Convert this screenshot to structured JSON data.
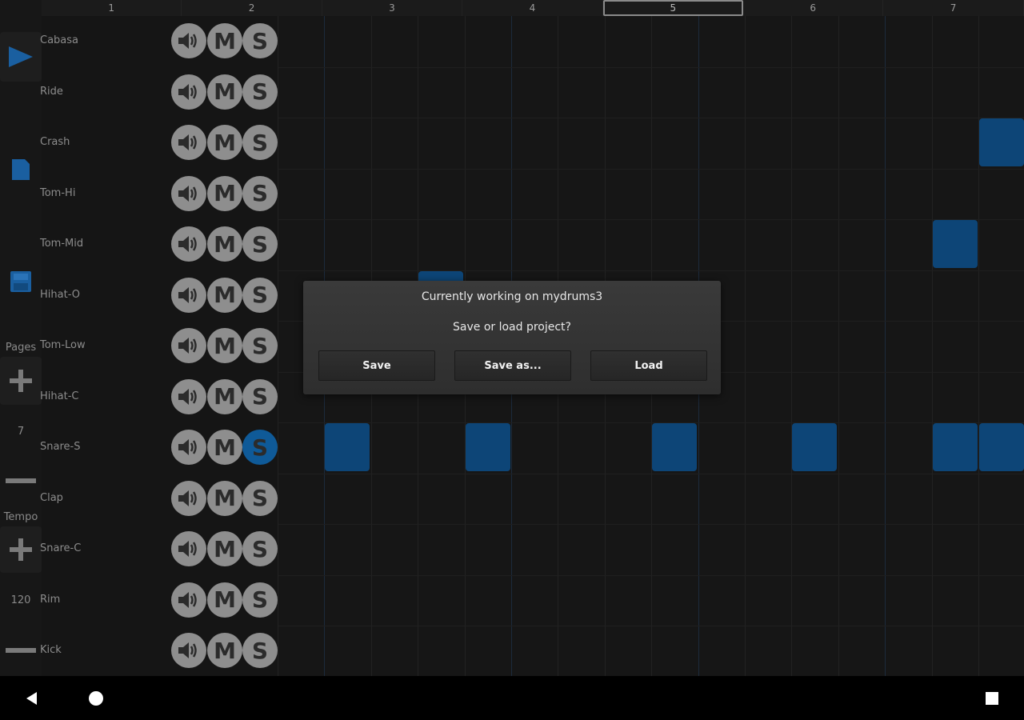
{
  "ruler": {
    "pages": [
      "1",
      "2",
      "3",
      "4",
      "5",
      "6",
      "7"
    ],
    "active_page": "5"
  },
  "toolbar": {
    "play_icon": "play-icon",
    "new_icon": "new-file-icon",
    "save_icon": "save-disk-icon",
    "pages_label": "Pages",
    "pages_value": "7",
    "tempo_label": "Tempo",
    "tempo_value": "120"
  },
  "tracks": [
    {
      "name": "Cabasa",
      "solo": false
    },
    {
      "name": "Ride",
      "solo": false
    },
    {
      "name": "Crash",
      "solo": false
    },
    {
      "name": "Tom-Hi",
      "solo": false
    },
    {
      "name": "Tom-Mid",
      "solo": false
    },
    {
      "name": "Hihat-O",
      "solo": false
    },
    {
      "name": "Tom-Low",
      "solo": false
    },
    {
      "name": "Hihat-C",
      "solo": false
    },
    {
      "name": "Snare-S",
      "solo": true
    },
    {
      "name": "Clap",
      "solo": false
    },
    {
      "name": "Snare-C",
      "solo": false
    },
    {
      "name": "Rim",
      "solo": false
    },
    {
      "name": "Kick",
      "solo": false
    }
  ],
  "controls": {
    "mute_symbol": "M",
    "solo_symbol": "S",
    "volume_icon": "speaker-icon"
  },
  "active_cells": [
    {
      "track": 2,
      "step": 15
    },
    {
      "track": 4,
      "step": 14
    },
    {
      "track": 5,
      "step": 3
    },
    {
      "track": 8,
      "step": 1
    },
    {
      "track": 8,
      "step": 4
    },
    {
      "track": 8,
      "step": 8
    },
    {
      "track": 8,
      "step": 11
    },
    {
      "track": 8,
      "step": 14
    },
    {
      "track": 8,
      "step": 15
    }
  ],
  "dialog": {
    "title": "Currently working on mydrums3",
    "question": "Save or load project?",
    "buttons": [
      "Save",
      "Save as...",
      "Load"
    ]
  },
  "navbar": {
    "back_icon": "back-triangle-icon",
    "home_icon": "home-circle-icon",
    "recents_icon": "recents-square-icon"
  },
  "colors": {
    "accent": "#0f5a98",
    "cell": "#0d4577",
    "control": "#8e8e8e"
  }
}
